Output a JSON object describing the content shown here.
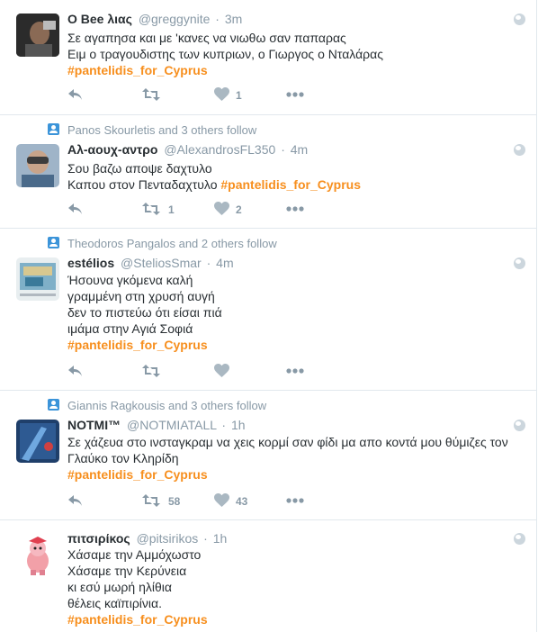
{
  "tweets": [
    {
      "context": null,
      "fullname": "Ο Bee λιας",
      "username": "@greggynite",
      "time": "3m",
      "lines": [
        "Σε αγαπησα και με 'κανες να νιωθω σαν παπαρας",
        "Ειμ ο τραγουδιστης των κυπριων, ο Γιωργος ο Νταλάρας"
      ],
      "hashtag_line": "#pantelidis_for_Cyprus",
      "hashtag_inline_prefix": null,
      "retweets": "",
      "likes": "1"
    },
    {
      "context": "Panos Skourletis and 3 others follow",
      "fullname": "Αλ-αουχ-αντρο",
      "username": "@AlexandrosFL350",
      "time": "4m",
      "lines": [
        "Σου βαζω αποψε δαχτυλο"
      ],
      "hashtag_inline_prefix": "Καπου στον Πενταδαχτυλο ",
      "hashtag_line": "#pantelidis_for_Cyprus",
      "retweets": "1",
      "likes": "2"
    },
    {
      "context": "Theodoros Pangalos and 2 others follow",
      "fullname": "estélios",
      "username": "@SteliosSmar",
      "time": "4m",
      "lines": [
        "Ήσουνα γκόμενα καλή",
        "γραμμένη στη χρυσή αυγή",
        "δεν το πιστεύω ότι είσαι πιά",
        "ιμάμα στην Αγιά Σοφιά"
      ],
      "hashtag_line": "#pantelidis_for_Cyprus",
      "hashtag_inline_prefix": null,
      "retweets": "",
      "likes": ""
    },
    {
      "context": "Giannis Ragkousis and 3 others follow",
      "fullname": "NOTMI™",
      "username": "@NOTMIATALL",
      "time": "1h",
      "lines": [
        "Σε χάζευα στο ινσταγκραμ να χεις κορμί σαν φίδι μα απο κοντά μου θύμιζες τον",
        "Γλαύκο τον Κληρίδη"
      ],
      "hashtag_line": "#pantelidis_for_Cyprus",
      "hashtag_inline_prefix": null,
      "retweets": "58",
      "likes": "43"
    },
    {
      "context": null,
      "fullname": "πιτσιρίκος",
      "username": "@pitsirikos",
      "time": "1h",
      "lines": [
        "Χάσαμε την Αμμόχωστο",
        "Χάσαμε την Κερύνεια",
        "κι εσύ μωρή ηλίθια",
        "θέλεις καϊπιρίνια."
      ],
      "hashtag_line": "#pantelidis_for_Cyprus",
      "hashtag_inline_prefix": null,
      "retweets": "",
      "likes": ""
    }
  ],
  "colors": {
    "hashtag": "#f78f1e",
    "muted": "#8899a6",
    "divider": "#e1e8ed",
    "context_icon": "#3b94d9"
  },
  "icons": [
    "reply-icon",
    "retweet-icon",
    "like-icon",
    "more-icon",
    "globe-icon",
    "follow-context-icon"
  ]
}
